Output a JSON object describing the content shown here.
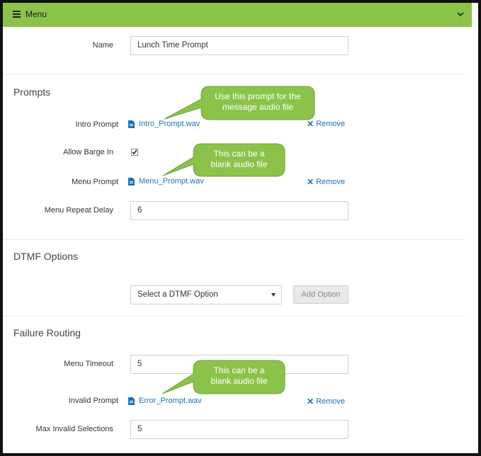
{
  "header": {
    "title": "Menu"
  },
  "name_field": {
    "label": "Name",
    "value": "Lunch Time Prompt"
  },
  "prompts": {
    "title": "Prompts",
    "intro": {
      "label": "Intro Prompt",
      "file": "Intro_Prompt.wav",
      "remove": "Remove"
    },
    "barge": {
      "label": "Allow Barge In",
      "checked": true
    },
    "menu": {
      "label": "Menu Prompt",
      "file": "Menu_Prompt.wav",
      "remove": "Remove"
    },
    "repeat": {
      "label": "Menu Repeat Delay",
      "value": "6"
    }
  },
  "dtmf": {
    "title": "DTMF Options",
    "select_value": "Select a DTMF Option",
    "add_button": "Add Option"
  },
  "failure": {
    "title": "Failure Routing",
    "timeout": {
      "label": "Menu Timeout",
      "value": "5"
    },
    "invalid": {
      "label": "Invalid Prompt",
      "file": "Error_Prompt.wav",
      "remove": "Remove"
    },
    "max_invalid": {
      "label": "Max Invalid Selections",
      "value": "5"
    }
  },
  "callouts": {
    "intro_line1": "Use this prompt for the",
    "intro_line2": "message audio file",
    "menu_line1": "This can be a",
    "menu_line2": "blank audio file",
    "error_line1": "This can be a",
    "error_line2": "blank audio file"
  },
  "colors": {
    "header": "#8bc34a",
    "link": "#1f6fb2",
    "callout": "#8bc34a"
  }
}
